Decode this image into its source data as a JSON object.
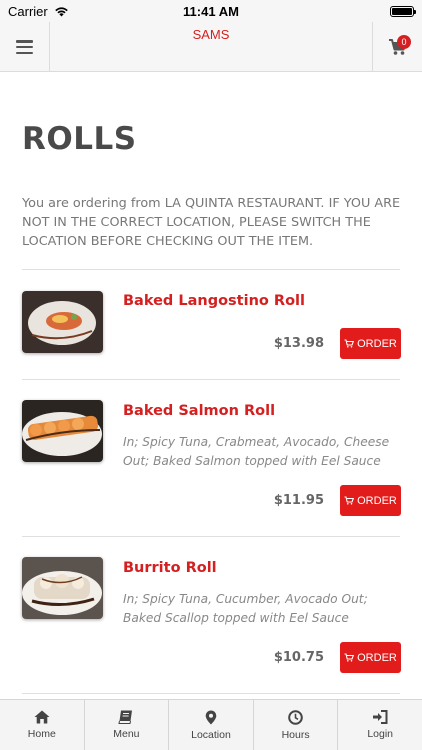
{
  "status_bar": {
    "carrier": "Carrier",
    "time": "11:41 AM"
  },
  "header": {
    "title": "SAMS",
    "cart_count": "0"
  },
  "page": {
    "title": "ROLLS",
    "notice": "You are ordering from LA QUINTA RESTAURANT. IF YOU ARE NOT IN THE CORRECT LOCATION, PLEASE SWITCH THE LOCATION BEFORE CHECKING OUT THE ITEM."
  },
  "items": [
    {
      "name": "Baked Langostino Roll",
      "description": "",
      "price": "$13.98",
      "order_label": "ORDER"
    },
    {
      "name": "Baked Salmon Roll",
      "description": "In; Spicy Tuna, Crabmeat, Avocado, Cheese Out; Baked Salmon topped with Eel Sauce",
      "price": "$11.95",
      "order_label": "ORDER"
    },
    {
      "name": "Burrito Roll",
      "description": "In; Spicy Tuna, Cucumber, Avocado Out; Baked Scallop topped with Eel Sauce",
      "price": "$10.75",
      "order_label": "ORDER"
    }
  ],
  "tabs": [
    {
      "label": "Home",
      "icon": "home-icon"
    },
    {
      "label": "Menu",
      "icon": "menu-book-icon"
    },
    {
      "label": "Location",
      "icon": "location-pin-icon"
    },
    {
      "label": "Hours",
      "icon": "clock-icon"
    },
    {
      "label": "Login",
      "icon": "login-icon"
    }
  ],
  "colors": {
    "accent": "#d42020",
    "button": "#e21b1b"
  }
}
